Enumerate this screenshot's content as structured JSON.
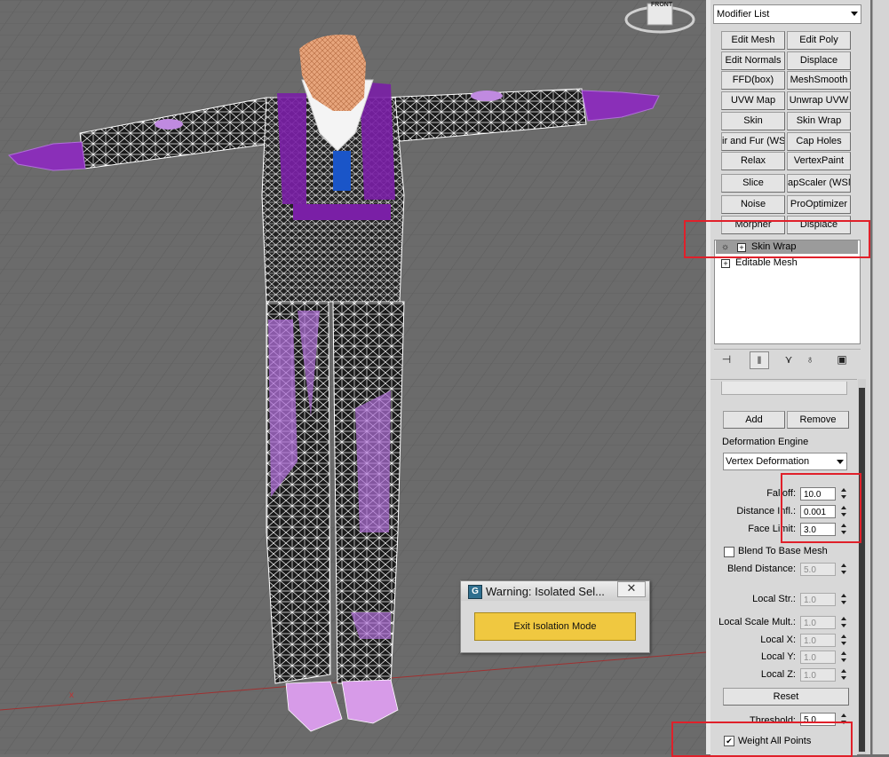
{
  "viewport": {
    "viewcube_label": "FRONT",
    "axis_label": "x",
    "warning_dialog": {
      "title": "Warning: Isolated Sel...",
      "close_label": "✕",
      "exit_button_label": "Exit Isolation Mode"
    }
  },
  "command_panel": {
    "modifier_list_label": "Modifier List",
    "modifier_buttons": [
      "Edit Mesh",
      "Edit Poly",
      "Edit Normals",
      "Displace",
      "FFD(box)",
      "MeshSmooth",
      "UVW Map",
      "Unwrap UVW",
      "Skin",
      "Skin Wrap",
      "ir and Fur (WS",
      "Cap Holes",
      "Relax",
      "VertexPaint",
      "Slice",
      "apScaler (WSM",
      "Noise",
      "ProOptimizer",
      "Morpher",
      "Displace"
    ],
    "stack": {
      "items": [
        {
          "label": "Skin Wrap",
          "selected": true
        },
        {
          "label": "Editable Mesh",
          "selected": false
        }
      ]
    },
    "rollout": {
      "add_label": "Add",
      "remove_label": "Remove",
      "deformation_engine_label": "Deformation Engine",
      "deformation_engine_value": "Vertex Deformation",
      "falloff_label": "Falloff:",
      "falloff_value": "10.0",
      "distance_infl_label": "Distance Infl.:",
      "distance_infl_value": "0.001",
      "face_limit_label": "Face Limit:",
      "face_limit_value": "3.0",
      "blend_to_base_label": "Blend To Base Mesh",
      "blend_to_base_checked": false,
      "blend_distance_label": "Blend Distance:",
      "blend_distance_value": "5.0",
      "local_str_label": "Local Str.:",
      "local_str_value": "1.0",
      "local_scale_mult_label": "Local Scale Mult.:",
      "local_scale_mult_value": "1.0",
      "local_x_label": "Local X:",
      "local_x_value": "1.0",
      "local_y_label": "Local Y:",
      "local_y_value": "1.0",
      "local_z_label": "Local Z:",
      "local_z_value": "1.0",
      "reset_label": "Reset",
      "threshold_label": "Threshold:",
      "threshold_value": "5.0",
      "weight_all_points_label": "Weight All Points",
      "weight_all_points_checked": true,
      "check_mark": "✔"
    }
  },
  "colors": {
    "highlight_box": "#e0202a",
    "exit_button": "#f0c840",
    "viewport_bg": "#6b6b6b",
    "mesh_purple": "#b070d8"
  }
}
